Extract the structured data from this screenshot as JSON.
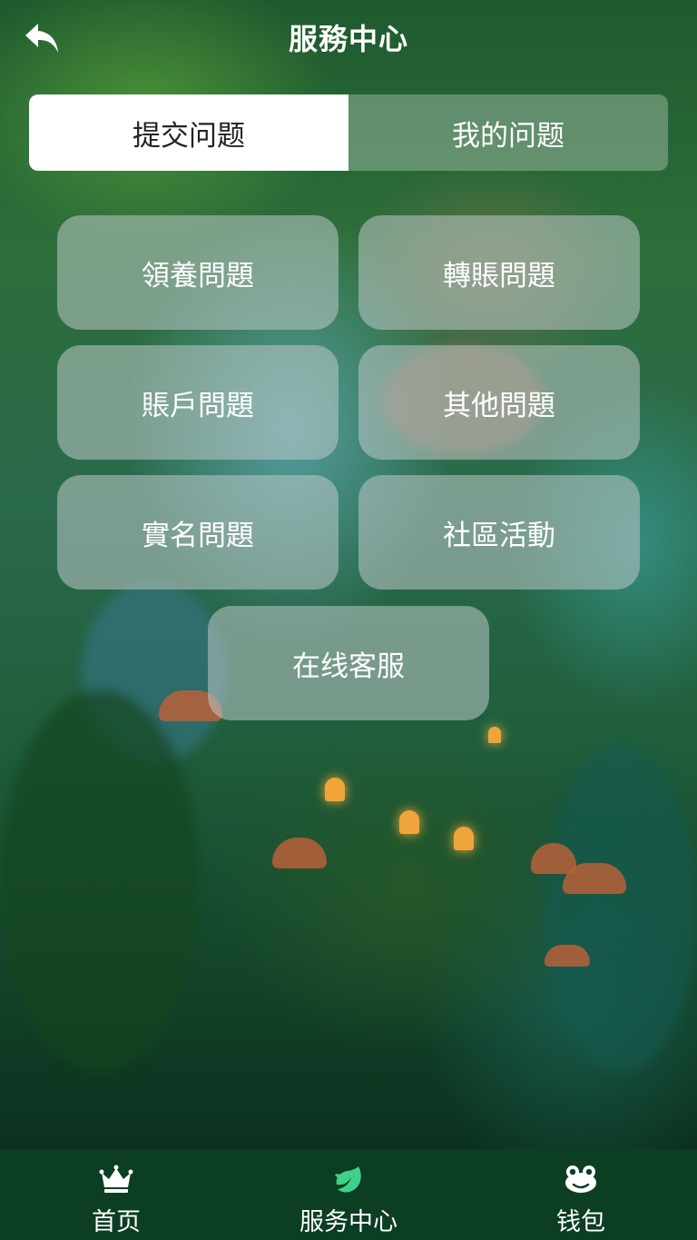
{
  "header": {
    "title": "服務中心",
    "back_icon": "back-arrow-icon"
  },
  "tabs": [
    {
      "label": "提交问题",
      "active": true
    },
    {
      "label": "我的问题",
      "active": false
    }
  ],
  "categories": [
    {
      "label": "領養問題"
    },
    {
      "label": "轉賬問題"
    },
    {
      "label": "賬戶問題"
    },
    {
      "label": "其他問題"
    },
    {
      "label": "實名問題"
    },
    {
      "label": "社區活動"
    },
    {
      "label": "在线客服"
    }
  ],
  "bottom_nav": {
    "items": [
      {
        "label": "首页",
        "icon": "crown-icon",
        "active": false
      },
      {
        "label": "服务中心",
        "icon": "leaf-service-icon",
        "active": true
      },
      {
        "label": "钱包",
        "icon": "frog-wallet-icon",
        "active": false
      }
    ]
  },
  "colors": {
    "nav_background": "#0c3e24",
    "active_icon": "#3fd08a",
    "tab_active_bg": "#ffffff",
    "tab_active_text": "#222222"
  }
}
